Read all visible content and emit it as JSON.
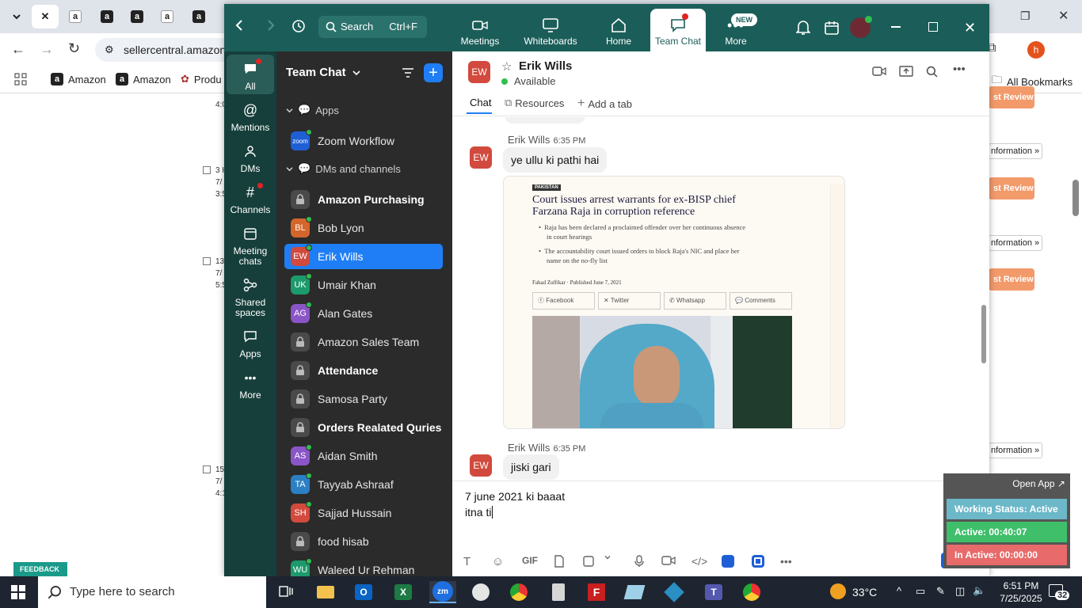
{
  "browser": {
    "url": "sellercentral.amazon",
    "bookmarks": [
      {
        "label": "Amazon"
      },
      {
        "label": "Amazon"
      },
      {
        "label": "Produ"
      }
    ],
    "all_bookmarks": "All Bookmarks",
    "profile_initial": "h",
    "page_rows": [
      {
        "line1": "4:0"
      },
      {
        "line1": "3 H",
        "line2": "7/",
        "line3": "3:5"
      },
      {
        "line1": "13",
        "line2": "7/",
        "line3": "5:5"
      },
      {
        "line1": "15",
        "line2": "7/",
        "line3": "4:1"
      }
    ],
    "right_buttons": [
      "st Review",
      "st Review",
      "st Review",
      "st Review"
    ],
    "right_info": [
      "nformation »",
      "nformation »",
      "nformation »",
      "nformation »",
      "nformation »"
    ],
    "feedback": "FEEDBACK ✕"
  },
  "zoom": {
    "search": {
      "label": "Search",
      "shortcut": "Ctrl+F"
    },
    "nav": [
      {
        "label": "Meetings"
      },
      {
        "label": "Whiteboards"
      },
      {
        "label": "Home"
      },
      {
        "label": "Team Chat"
      },
      {
        "label": "More"
      }
    ],
    "new_badge": "NEW",
    "rail": [
      {
        "label": "All"
      },
      {
        "label": "Mentions"
      },
      {
        "label": "DMs"
      },
      {
        "label": "Channels"
      },
      {
        "label": "Meeting chats"
      },
      {
        "label": "Shared spaces"
      },
      {
        "label": "Apps"
      },
      {
        "label": "More"
      }
    ],
    "list_title": "Team Chat",
    "sections": {
      "apps": "Apps",
      "dms": "DMs and channels"
    },
    "app_item": "Zoom Workflow",
    "app_logo": "zoom",
    "channels": [
      {
        "name": "Amazon Purchasing",
        "type": "lock",
        "bold": true
      },
      {
        "name": "Bob Lyon",
        "initials": "BL",
        "color": "#d4662b",
        "type": "user"
      },
      {
        "name": "Erik Wills",
        "initials": "EW",
        "color": "#d14a3d",
        "type": "user",
        "active": true
      },
      {
        "name": "Umair Khan",
        "initials": "UK",
        "color": "#1d9a6c",
        "type": "user"
      },
      {
        "name": "Alan Gates",
        "initials": "AG",
        "color": "#8a55c6",
        "type": "user"
      },
      {
        "name": "Amazon Sales Team",
        "type": "lock"
      },
      {
        "name": "Attendance",
        "type": "lock",
        "bold": true
      },
      {
        "name": "Samosa Party",
        "type": "lock"
      },
      {
        "name": "Orders Realated Quries",
        "type": "lock",
        "bold": true
      },
      {
        "name": "Aidan Smith",
        "initials": "AS",
        "color": "#8a55c6",
        "type": "user"
      },
      {
        "name": "Tayyab Ashraaf",
        "initials": "TA",
        "color": "#2b7fc4",
        "type": "user"
      },
      {
        "name": "Sajjad Hussain",
        "initials": "SH",
        "color": "#d14a3d",
        "type": "user"
      },
      {
        "name": "food hisab",
        "type": "lock"
      },
      {
        "name": "Waleed Ur Rehman",
        "initials": "WU",
        "color": "#1d9a6c",
        "type": "user"
      }
    ],
    "chat": {
      "contact": "Erik Wills",
      "initials": "EW",
      "status": "Available",
      "tabs": [
        "Chat",
        "Resources",
        "Add a tab"
      ],
      "messages": [
        {
          "sender": "Erik Wills",
          "time": "6:35 PM",
          "text": "ye ullu ki pathi hai"
        },
        {
          "sender": "Erik Wills",
          "time": "6:35 PM",
          "text": "jiski gari"
        }
      ],
      "article": {
        "tag": "PAKISTAN",
        "headline1": "Court issues arrest warrants for ex-BISP chief",
        "headline2": "Farzana Raja in corruption reference",
        "bullet1a": "Raja has been declared a proclaimed offender over her continuous absence",
        "bullet1b": "in court hearings",
        "bullet2a": "The accountability court issued orders to block Raja's NIC and place her",
        "bullet2b": "name on the no-fly list",
        "byline": "Fahad Zulfikar",
        "published": "Published June 7, 2021",
        "share": [
          "Facebook",
          "Twitter",
          "Whatsapp",
          "Comments"
        ]
      },
      "composer_lines": [
        "7 june 2021 ki baaat",
        "itna ti"
      ],
      "gif_label": "GIF"
    }
  },
  "widget": {
    "open_app": "Open App ↗",
    "working": "Working Status: Active",
    "active": "Active: 00:40:07",
    "inactive": "In Active: 00:00:00"
  },
  "taskbar": {
    "search_placeholder": "Type here to search",
    "weather": "33°C",
    "time": "6:51 PM",
    "date": "7/25/2025",
    "notif_count": "32"
  },
  "colors": {
    "zoom_header": "#1b5e59",
    "accent_blue": "#1f7ef5",
    "avatar_ew": "#d14a3d",
    "widget_active": "#3fbf6a",
    "widget_inactive": "#e86a6a",
    "widget_status": "#6cb8c9"
  }
}
